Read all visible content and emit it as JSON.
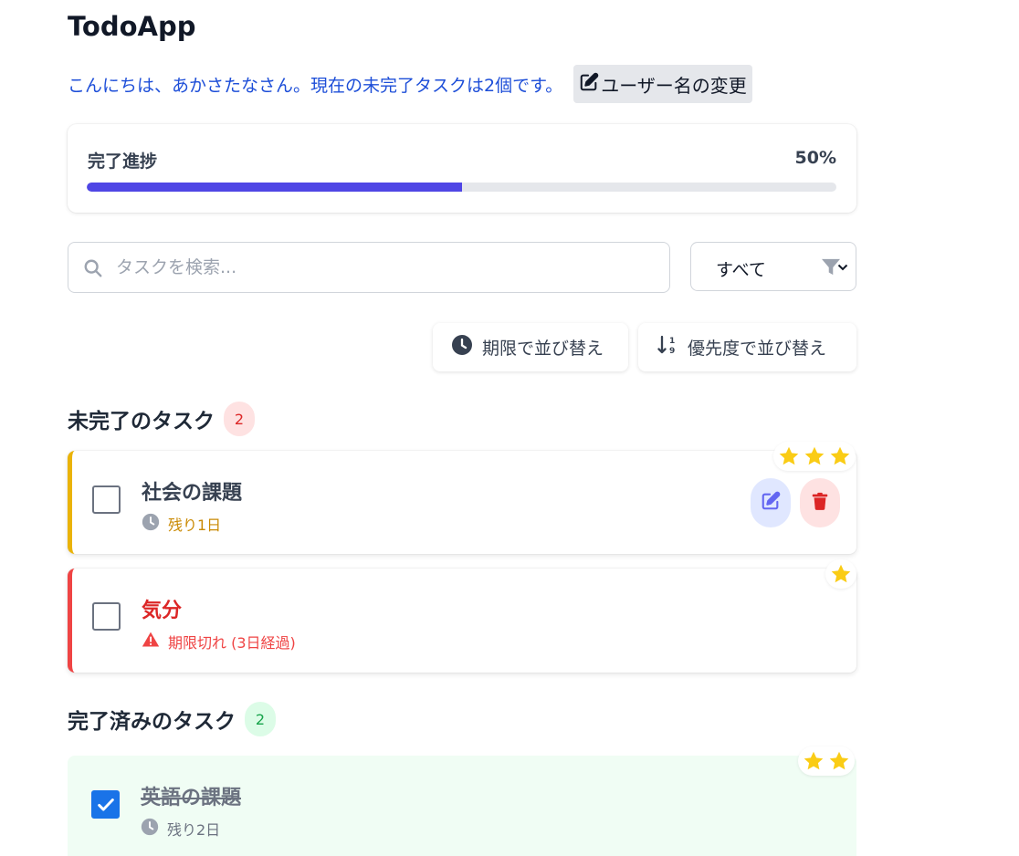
{
  "app": {
    "title": "TodoApp"
  },
  "greeting": {
    "text": "こんにちは、あかさたなさん。現在の未完了タスクは2個です。",
    "change_name_label": "ユーザー名の変更"
  },
  "progress": {
    "label": "完了進捗",
    "percent_text": "50%",
    "value": 0.5,
    "fill_color": "#4f46e5"
  },
  "search": {
    "placeholder": "タスクを検索...",
    "value": ""
  },
  "filter": {
    "selected": "すべて",
    "icon": "filter-icon"
  },
  "sort": {
    "by_due_label": "期限で並び替え",
    "by_priority_label": "優先度で並び替え"
  },
  "incomplete": {
    "title": "未完了のタスク",
    "count": "2",
    "tasks": [
      {
        "title": "社会の課題",
        "meta": "残り1日",
        "meta_icon": "clock-icon",
        "priority": 3,
        "checked": false,
        "border_color": "#eab308"
      },
      {
        "title": "気分",
        "meta": "期限切れ (3日経過)",
        "meta_icon": "warning-icon",
        "priority": 1,
        "checked": false,
        "border_color": "#ef4444"
      }
    ]
  },
  "completed": {
    "title": "完了済みのタスク",
    "count": "2",
    "tasks": [
      {
        "title": "英語の課題",
        "meta": "残り2日",
        "meta_icon": "clock-icon",
        "priority": 2,
        "checked": true
      }
    ]
  },
  "colors": {
    "accent": "#4f46e5",
    "link": "#1d4ed8",
    "star": "#facc15",
    "overdue": "#dc2626",
    "done_bg": "#f0fdf4"
  }
}
